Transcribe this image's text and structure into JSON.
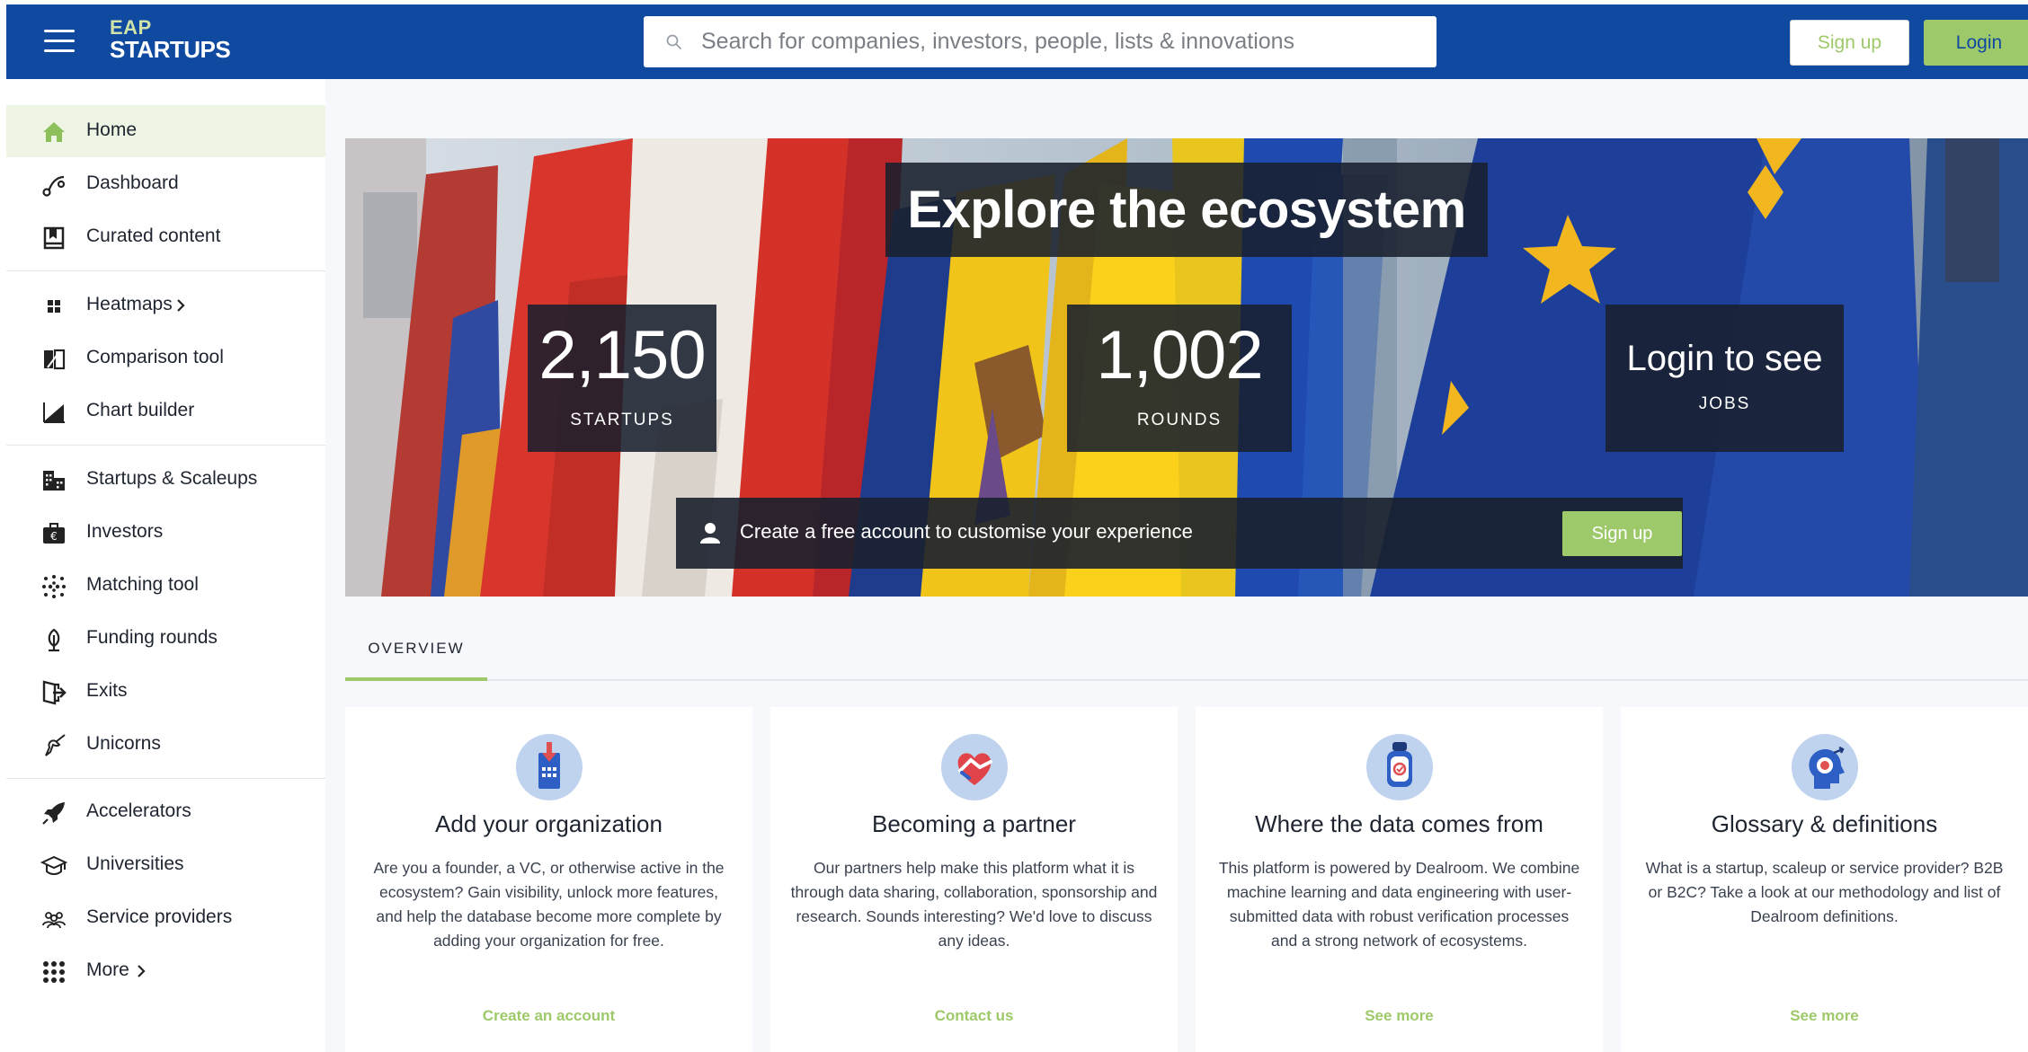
{
  "header": {
    "logo_line1": "EAP",
    "logo_line2": "STARTUPS",
    "search_placeholder": "Search for companies, investors, people, lists & innovations",
    "signup_label": "Sign up",
    "login_label": "Login"
  },
  "sidebar": {
    "items": [
      {
        "label": "Home",
        "icon": "home-icon"
      },
      {
        "label": "Dashboard",
        "icon": "dashboard-icon"
      },
      {
        "label": "Curated content",
        "icon": "bookmark-icon"
      },
      {
        "label": "Heatmaps",
        "icon": "grid-icon"
      },
      {
        "label": "Comparison tool",
        "icon": "compare-icon"
      },
      {
        "label": "Chart builder",
        "icon": "area-chart-icon"
      },
      {
        "label": "Startups & Scaleups",
        "icon": "buildings-icon"
      },
      {
        "label": "Investors",
        "icon": "briefcase-euro-icon"
      },
      {
        "label": "Matching tool",
        "icon": "dots-matrix-icon"
      },
      {
        "label": "Funding rounds",
        "icon": "seedling-icon"
      },
      {
        "label": "Exits",
        "icon": "exit-door-icon"
      },
      {
        "label": "Unicorns",
        "icon": "unicorn-icon"
      },
      {
        "label": "Accelerators",
        "icon": "rocket-icon"
      },
      {
        "label": "Universities",
        "icon": "graduation-cap-icon"
      },
      {
        "label": "Service providers",
        "icon": "people-group-icon"
      },
      {
        "label": "More",
        "icon": "apps-grid-icon"
      }
    ]
  },
  "hero": {
    "title": "Explore the ecosystem",
    "stats": [
      {
        "value": "2,150",
        "label": "STARTUPS"
      },
      {
        "value": "1,002",
        "label": "ROUNDS"
      },
      {
        "value": "Login to see",
        "label": "JOBS"
      }
    ],
    "promo_text": "Create a free account to customise your experience",
    "promo_button": "Sign up"
  },
  "tabs": [
    "OVERVIEW"
  ],
  "cards": [
    {
      "title": "Add your organization",
      "description": "Are you a founder, a VC, or otherwise active in the ecosystem? Gain visibility, unlock more features, and help the database become more complete by adding your organization for free.",
      "link": "Create an account"
    },
    {
      "title": "Becoming a partner",
      "description": "Our partners help make this platform what it is through data sharing, collaboration, sponsorship and research. Sounds interesting? We'd love to discuss any ideas.",
      "link": "Contact us"
    },
    {
      "title": "Where the data comes from",
      "description": "This platform is powered by Dealroom. We combine machine learning and data engineering with user-submitted data with robust verification processes and a strong network of ecosystems.",
      "link": "See more"
    },
    {
      "title": "Glossary & definitions",
      "description": "What is a startup, scaleup or service provider? B2B or B2C? Take a look at our methodology and list of Dealroom definitions.",
      "link": "See more"
    }
  ],
  "colors": {
    "brand_blue": "#0f4aa0",
    "accent_green": "#9ec96a",
    "active_bg": "#eef5e4"
  }
}
